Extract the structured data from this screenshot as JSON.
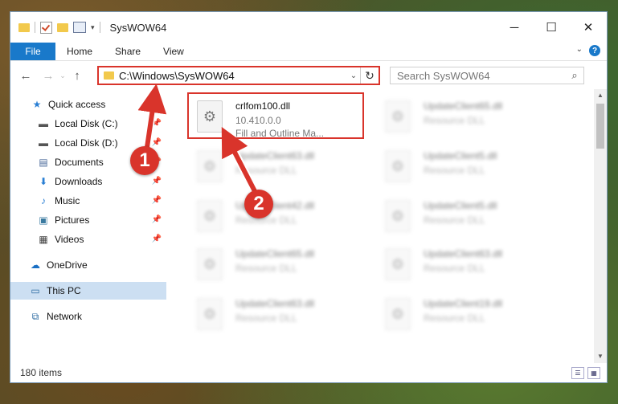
{
  "window": {
    "title": "SysWOW64"
  },
  "ribbon": {
    "file": "File",
    "tabs": [
      "Home",
      "Share",
      "View"
    ]
  },
  "address": {
    "path": "C:\\Windows\\SysWOW64"
  },
  "search": {
    "placeholder": "Search SysWOW64"
  },
  "sidebar": {
    "items": [
      {
        "label": "Quick access",
        "icon": "star-icon"
      },
      {
        "label": "Local Disk (C:)",
        "icon": "drive-icon",
        "pinned": true
      },
      {
        "label": "Local Disk (D:)",
        "icon": "drive-icon",
        "pinned": true
      },
      {
        "label": "Documents",
        "icon": "document-icon",
        "pinned": true
      },
      {
        "label": "Downloads",
        "icon": "download-icon",
        "pinned": true
      },
      {
        "label": "Music",
        "icon": "music-icon",
        "pinned": true
      },
      {
        "label": "Pictures",
        "icon": "picture-icon",
        "pinned": true
      },
      {
        "label": "Videos",
        "icon": "video-icon",
        "pinned": true
      },
      {
        "label": "OneDrive",
        "icon": "cloud-icon"
      },
      {
        "label": "This PC",
        "icon": "computer-icon",
        "selected": true
      },
      {
        "label": "Network",
        "icon": "network-icon"
      }
    ]
  },
  "files": {
    "highlighted": {
      "name": "crlfom100.dll",
      "version": "10.410.0.0",
      "description": "Fill and Outline Ma..."
    },
    "blurred": [
      {
        "name": "UpdateClient65.dll",
        "type": "Resource DLL"
      },
      {
        "name": "UpdateClient63.dll",
        "type": "Resource DLL"
      },
      {
        "name": "UpdateClient5.dll",
        "type": "Resource DLL"
      },
      {
        "name": "UpdateClient42.dll",
        "type": "Resource DLL"
      },
      {
        "name": "UpdateClient5.dll",
        "type": "Resource DLL"
      },
      {
        "name": "UpdateClient65.dll",
        "type": "Resource DLL"
      },
      {
        "name": "UpdateClient63.dll",
        "type": "Resource DLL"
      },
      {
        "name": "UpdateClient63.dll",
        "type": "Resource DLL"
      },
      {
        "name": "UpdateClient19.dll",
        "type": "Resource DLL"
      }
    ]
  },
  "status": {
    "count": "180 items"
  },
  "markers": [
    "1",
    "2"
  ],
  "colors": {
    "highlight": "#d9342b",
    "accent": "#1979ca"
  }
}
